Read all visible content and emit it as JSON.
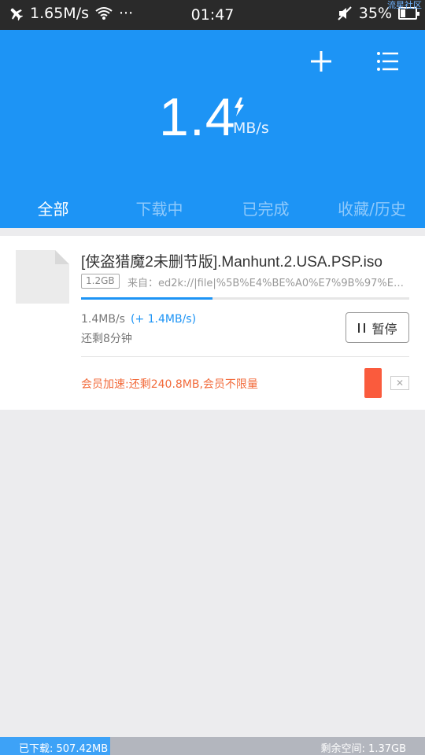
{
  "status_bar": {
    "net_speed": "1.65M/s",
    "more": "···",
    "time": "01:47",
    "battery": "35%",
    "watermark": "流星社区",
    "icons": [
      "airplane-icon",
      "wifi-icon",
      "mute-icon",
      "battery-icon"
    ]
  },
  "header": {
    "speed_value": "1.4",
    "speed_unit": "MB/s",
    "icons": [
      "add-icon",
      "menu-list-icon",
      "bolt-icon"
    ]
  },
  "tabs": [
    {
      "label": "全部",
      "active": true
    },
    {
      "label": "下载中",
      "active": false
    },
    {
      "label": "已完成",
      "active": false
    },
    {
      "label": "收藏/历史",
      "active": false
    }
  ],
  "download": {
    "file_name": "[侠盗猎魔2未删节版].Manhunt.2.USA.PSP.iso",
    "size": "1.2GB",
    "source": "来自：ed2k://|file|%5B%E4%BE%A0%E7%9B%97%E7…",
    "progress": 0.4,
    "speed": "1.4MB/s",
    "boost": "(+ 1.4MB/s)",
    "remaining": "还剩8分钟",
    "pause_label": "暂停",
    "vip_message": "会员加速:还剩240.8MB,会员不限量",
    "close_mark": "✕"
  },
  "storage": {
    "used": "已下载: 507.42MB",
    "free": "剩余空间: 1.37GB",
    "used_fraction": 0.26
  },
  "colors": {
    "accent": "#1d94f5",
    "vip": "#f26a3a",
    "vip_button": "#fa5b3d"
  }
}
